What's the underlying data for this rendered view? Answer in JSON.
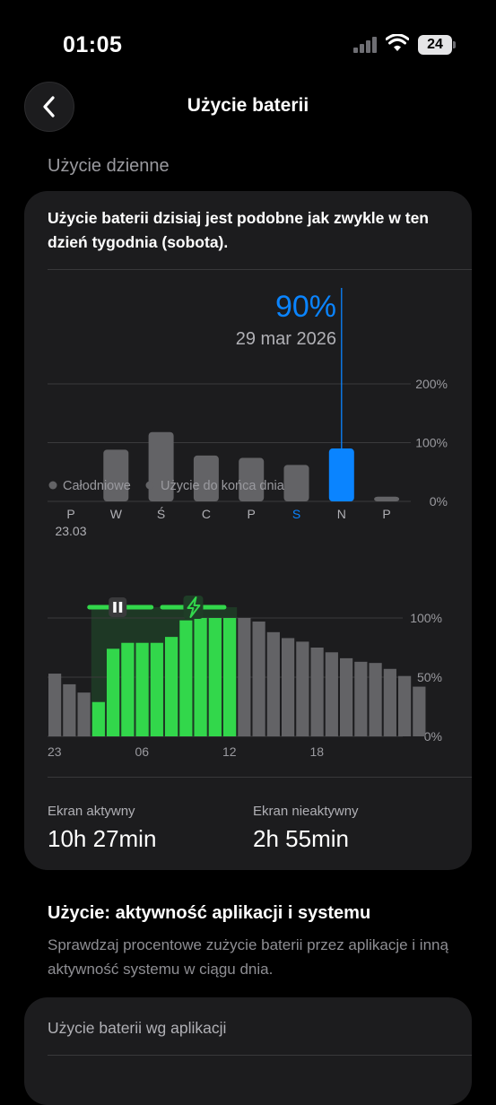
{
  "status": {
    "time": "01:05",
    "battery": "24"
  },
  "header": {
    "title": "Użycie baterii"
  },
  "daily": {
    "section_label": "Użycie dzienne",
    "description": "Użycie baterii dzisiaj jest podobne jak zwykle w ten dzień tygodnia (sobota).",
    "selected_value": "90%",
    "selected_date": "29 mar 2026",
    "week_legend": [
      "Całodniowe",
      "Użycie do końca dnia"
    ],
    "stats": {
      "screen_on_label": "Ekran aktywny",
      "screen_on_value": "10h 27min",
      "screen_off_label": "Ekran nieaktywny",
      "screen_off_value": "2h 55min"
    }
  },
  "usage_section": {
    "title": "Użycie: aktywność aplikacji i systemu",
    "description": "Sprawdzaj procentowe zużycie baterii przez aplikacje i inną aktywność systemu w ciągu dnia."
  },
  "per_app": {
    "title": "Użycie baterii wg aplikacji"
  },
  "colors": {
    "accent": "#0a84ff",
    "charging": "#32d74b",
    "bar": "#636366",
    "card": "#1c1c1e"
  },
  "chart_data": [
    {
      "type": "bar",
      "title": "",
      "categories": [
        "P",
        "W",
        "Ś",
        "C",
        "P",
        "S",
        "N",
        "P"
      ],
      "first_date_label": "23.03",
      "highlight_label_index": 5,
      "selected_index": 6,
      "values": [
        0,
        88,
        118,
        78,
        74,
        62,
        90,
        8
      ],
      "ylim": [
        0,
        200
      ],
      "yticks": [
        0,
        100,
        200
      ],
      "ytick_labels": [
        "0%",
        "100%",
        "200%"
      ]
    },
    {
      "type": "bar",
      "title": "",
      "x_labels": [
        "23",
        "06",
        "12",
        "18"
      ],
      "yticks": [
        0,
        50,
        100
      ],
      "ytick_labels": [
        "0%",
        "50%",
        "100%"
      ],
      "ylim": [
        0,
        100
      ],
      "values": [
        53,
        44,
        37,
        29,
        74,
        79,
        79,
        79,
        84,
        98,
        100,
        100,
        100,
        100,
        97,
        88,
        83,
        80,
        75,
        71,
        66,
        63,
        62,
        57,
        51,
        42
      ],
      "charging_start_index": 3,
      "charging_end_index": 12,
      "charging_bands": [
        {
          "icon": "pause-icon",
          "from_bar": 3,
          "to_bar": 6
        },
        {
          "icon": "bolt-icon",
          "from_bar": 8,
          "to_bar": 11
        }
      ]
    }
  ]
}
